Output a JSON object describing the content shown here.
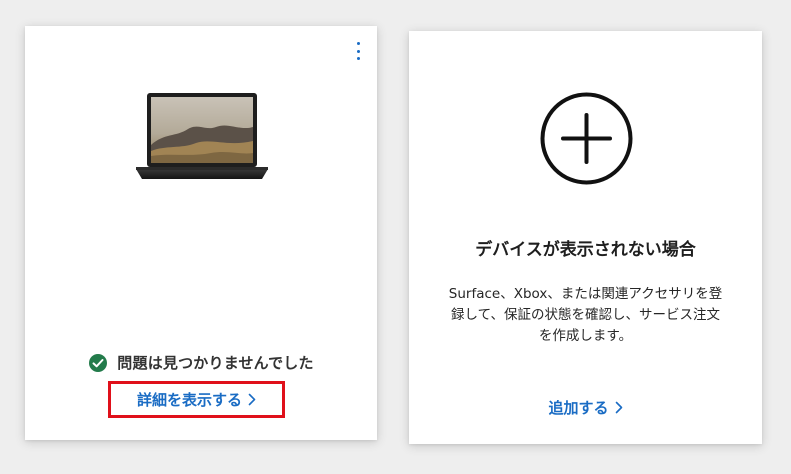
{
  "device_card": {
    "more_options_icon": "more-vertical-icon",
    "device_image": "laptop-image",
    "status_icon": "check-circle-icon",
    "status_text": "問題は見つかりませんでした",
    "details_link": "詳細を表示する",
    "chevron_icon": "chevron-right-icon",
    "colors": {
      "status_green": "#237b4b",
      "link_blue": "#1a6cc4",
      "highlight_red": "#e0101a"
    }
  },
  "add_card": {
    "plus_icon": "plus-circle-icon",
    "title": "デバイスが表示されない場合",
    "description_lines": [
      "Surface、Xbox、または関連アクセサリを登",
      "録して、保証の状態を確認し、サービス注文",
      "を作成します。"
    ],
    "add_link": "追加する",
    "chevron_icon": "chevron-right-icon"
  }
}
